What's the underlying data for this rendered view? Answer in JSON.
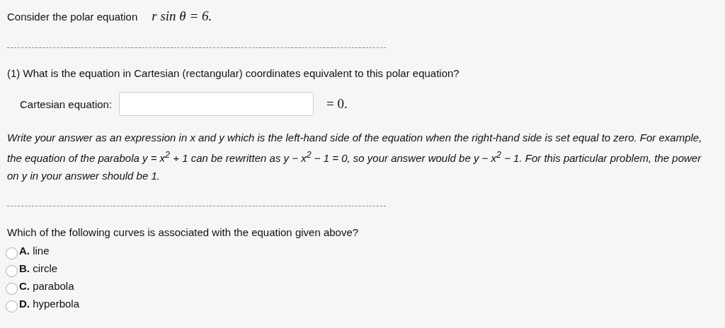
{
  "prompt": {
    "text": "Consider the polar equation",
    "math": "r sin θ = 6."
  },
  "question_1": {
    "title": "(1) What is the equation in Cartesian (rectangular) coordinates equivalent to this polar equation?",
    "field_label": "Cartesian equation:",
    "suffix": "= 0.",
    "instructions": "Write your answer as an expression in x and y which is the left-hand side of the equation when the right-hand side is set equal to zero. For example, the equation of the parabola y = x$^{2}$ + 1 can be rewritten as y − x$^{2}$ − 1 = 0, so your answer would be y − x$^{2}$ − 1. For this particular problem, the power on y in your answer should be 1."
  },
  "question_2": {
    "title": "Which of the following curves is associated with the equation given above?",
    "options": [
      {
        "label": "**A.** line",
        "selected": false
      },
      {
        "label": "**B.** circle",
        "selected": false
      },
      {
        "label": "**C.** parabola",
        "selected": false
      },
      {
        "label": "**D.** hyperbola",
        "selected": false
      }
    ]
  }
}
